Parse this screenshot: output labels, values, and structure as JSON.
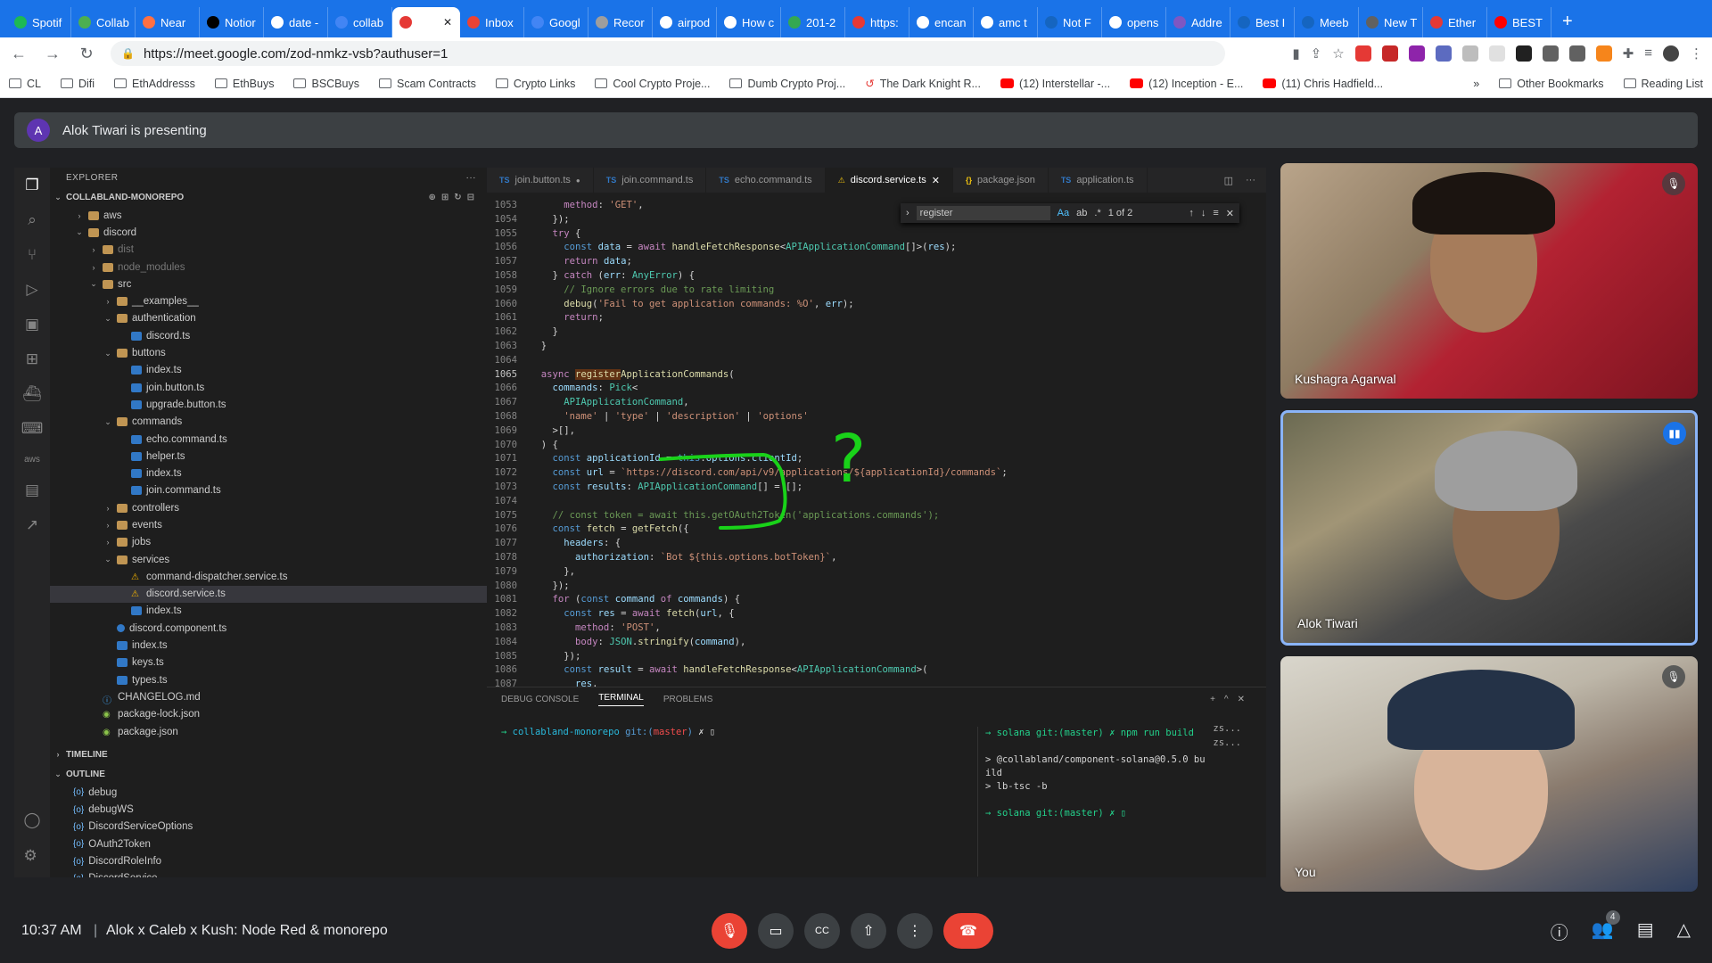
{
  "browser": {
    "tabs": [
      "Spotif",
      "Collab",
      "Near",
      "Notior",
      "date -",
      "collab",
      "",
      "Inbox",
      "Googl",
      "Recor",
      "airpod",
      "How c",
      "201-2",
      "https:",
      "encan",
      "amc t",
      "Not F",
      "opens",
      "Addre",
      "Best I",
      "Meeb",
      "New T",
      "Ether",
      "BEST"
    ],
    "active_tab_index": 6,
    "url": "https://meet.google.com/zod-nmkz-vsb?authuser=1",
    "bookmarks": [
      "CL",
      "Difi",
      "EthAddresss",
      "EthBuys",
      "BSCBuys",
      "Scam Contracts",
      "Crypto Links",
      "Cool Crypto Proje...",
      "Dumb Crypto Proj...",
      "The Dark Knight R...",
      "(12) Interstellar -...",
      "(12) Inception - E...",
      "(11) Chris Hadfield..."
    ],
    "bookmarks_right": [
      "Other Bookmarks",
      "Reading List"
    ]
  },
  "meet": {
    "presenter_initial": "A",
    "presenting_text": "Alok Tiwari is presenting",
    "time": "10:37 AM",
    "meeting_name": "Alok x Caleb x Kush: Node Red & monorepo",
    "participants_count": "4",
    "tiles": [
      {
        "name": "Kushagra Agarwal"
      },
      {
        "name": "Alok Tiwari"
      },
      {
        "name": "You"
      }
    ]
  },
  "vscode": {
    "explorer_label": "EXPLORER",
    "root": "COLLABLAND-MONOREPO",
    "tree": [
      {
        "label": "aws",
        "indent": 1,
        "type": "folder",
        "chev": "›"
      },
      {
        "label": "discord",
        "indent": 1,
        "type": "folder",
        "chev": "⌄"
      },
      {
        "label": "dist",
        "indent": 2,
        "type": "folder",
        "chev": "›",
        "dim": true
      },
      {
        "label": "node_modules",
        "indent": 2,
        "type": "folder",
        "chev": "›",
        "dim": true
      },
      {
        "label": "src",
        "indent": 2,
        "type": "folder",
        "chev": "⌄"
      },
      {
        "label": "__examples__",
        "indent": 3,
        "type": "folder",
        "chev": "›"
      },
      {
        "label": "authentication",
        "indent": 3,
        "type": "folder",
        "chev": "⌄"
      },
      {
        "label": "discord.ts",
        "indent": 4,
        "type": "ts"
      },
      {
        "label": "buttons",
        "indent": 3,
        "type": "folder",
        "chev": "⌄"
      },
      {
        "label": "index.ts",
        "indent": 4,
        "type": "ts"
      },
      {
        "label": "join.button.ts",
        "indent": 4,
        "type": "ts"
      },
      {
        "label": "upgrade.button.ts",
        "indent": 4,
        "type": "ts"
      },
      {
        "label": "commands",
        "indent": 3,
        "type": "folder",
        "chev": "⌄"
      },
      {
        "label": "echo.command.ts",
        "indent": 4,
        "type": "ts"
      },
      {
        "label": "helper.ts",
        "indent": 4,
        "type": "ts"
      },
      {
        "label": "index.ts",
        "indent": 4,
        "type": "ts"
      },
      {
        "label": "join.command.ts",
        "indent": 4,
        "type": "ts"
      },
      {
        "label": "controllers",
        "indent": 3,
        "type": "folder",
        "chev": "›"
      },
      {
        "label": "events",
        "indent": 3,
        "type": "folder",
        "chev": "›"
      },
      {
        "label": "jobs",
        "indent": 3,
        "type": "folder",
        "chev": "›"
      },
      {
        "label": "services",
        "indent": 3,
        "type": "folder",
        "chev": "⌄"
      },
      {
        "label": "command-dispatcher.service.ts",
        "indent": 4,
        "type": "svc"
      },
      {
        "label": "discord.service.ts",
        "indent": 4,
        "type": "svc",
        "selected": true
      },
      {
        "label": "index.ts",
        "indent": 4,
        "type": "ts"
      },
      {
        "label": "discord.component.ts",
        "indent": 3,
        "type": "cmp"
      },
      {
        "label": "index.ts",
        "indent": 3,
        "type": "ts"
      },
      {
        "label": "keys.ts",
        "indent": 3,
        "type": "ts"
      },
      {
        "label": "types.ts",
        "indent": 3,
        "type": "ts"
      },
      {
        "label": "CHANGELOG.md",
        "indent": 2,
        "type": "md"
      },
      {
        "label": "package-lock.json",
        "indent": 2,
        "type": "json"
      },
      {
        "label": "package.json",
        "indent": 2,
        "type": "json"
      }
    ],
    "timeline_label": "TIMELINE",
    "outline_label": "OUTLINE",
    "outline": [
      "debug",
      "debugWS",
      "DiscordServiceOptions",
      "OAuth2Token",
      "DiscordRoleInfo",
      "DiscordService"
    ],
    "editor_tabs": [
      {
        "label": "join.button.ts",
        "kind": "ts",
        "dot": true
      },
      {
        "label": "join.command.ts",
        "kind": "ts"
      },
      {
        "label": "echo.command.ts",
        "kind": "ts"
      },
      {
        "label": "discord.service.ts",
        "kind": "svc",
        "active": true,
        "close": true
      },
      {
        "label": "package.json",
        "kind": "json"
      },
      {
        "label": "application.ts",
        "kind": "ts"
      }
    ],
    "find": {
      "query": "register",
      "count": "1 of 2"
    },
    "panel_tabs": [
      "DEBUG CONSOLE",
      "TERMINAL",
      "PROBLEMS"
    ],
    "active_panel_tab": "TERMINAL",
    "terminal_left_prompt": "→ collabland-monorepo git:(master) ✗ ▯",
    "terminal_right": [
      "→ solana git:(master) ✗ npm run build",
      "",
      "> @collabland/component-solana@0.5.0 bu",
      "ild",
      "> lb-tsc -b",
      "",
      "→ solana git:(master) ✗ ▯"
    ],
    "terminal_list": [
      "zs...",
      "zs..."
    ]
  },
  "code": [
    {
      "n": "1053",
      "t": "      method: 'GET',"
    },
    {
      "n": "1054",
      "t": "    });"
    },
    {
      "n": "1055",
      "t": "    try {"
    },
    {
      "n": "1056",
      "t": "      const data = await handleFetchResponse<APIApplicationCommand[]>(res);"
    },
    {
      "n": "1057",
      "t": "      return data;"
    },
    {
      "n": "1058",
      "t": "    } catch (err: AnyError) {"
    },
    {
      "n": "1059",
      "t": "      // Ignore errors due to rate limiting"
    },
    {
      "n": "1060",
      "t": "      debug('Fail to get application commands: %O', err);"
    },
    {
      "n": "1061",
      "t": "      return;"
    },
    {
      "n": "1062",
      "t": "    }"
    },
    {
      "n": "1063",
      "t": "  }"
    },
    {
      "n": "1064",
      "t": ""
    },
    {
      "n": "1065",
      "t": "  async registerApplicationCommands(",
      "cur": true
    },
    {
      "n": "1066",
      "t": "    commands: Pick<"
    },
    {
      "n": "1067",
      "t": "      APIApplicationCommand,"
    },
    {
      "n": "1068",
      "t": "      'name' | 'type' | 'description' | 'options'"
    },
    {
      "n": "1069",
      "t": "    >[],"
    },
    {
      "n": "1070",
      "t": "  ) {"
    },
    {
      "n": "1071",
      "t": "    const applicationId = this.options.clientId;"
    },
    {
      "n": "1072",
      "t": "    const url = `https://discord.com/api/v9/applications/${applicationId}/commands`;"
    },
    {
      "n": "1073",
      "t": "    const results: APIApplicationCommand[] = [];"
    },
    {
      "n": "1074",
      "t": ""
    },
    {
      "n": "1075",
      "t": "    // const token = await this.getOAuth2Token('applications.commands');"
    },
    {
      "n": "1076",
      "t": "    const fetch = getFetch({"
    },
    {
      "n": "1077",
      "t": "      headers: {"
    },
    {
      "n": "1078",
      "t": "        authorization: `Bot ${this.options.botToken}`,"
    },
    {
      "n": "1079",
      "t": "      },"
    },
    {
      "n": "1080",
      "t": "    });"
    },
    {
      "n": "1081",
      "t": "    for (const command of commands) {"
    },
    {
      "n": "1082",
      "t": "      const res = await fetch(url, {"
    },
    {
      "n": "1083",
      "t": "        method: 'POST',"
    },
    {
      "n": "1084",
      "t": "        body: JSON.stringify(command),"
    },
    {
      "n": "1085",
      "t": "      });"
    },
    {
      "n": "1086",
      "t": "      const result = await handleFetchResponse<APIApplicationCommand>("
    },
    {
      "n": "1087",
      "t": "        res,"
    }
  ],
  "annotation": {
    "text": "?",
    "color": "#00e000"
  }
}
